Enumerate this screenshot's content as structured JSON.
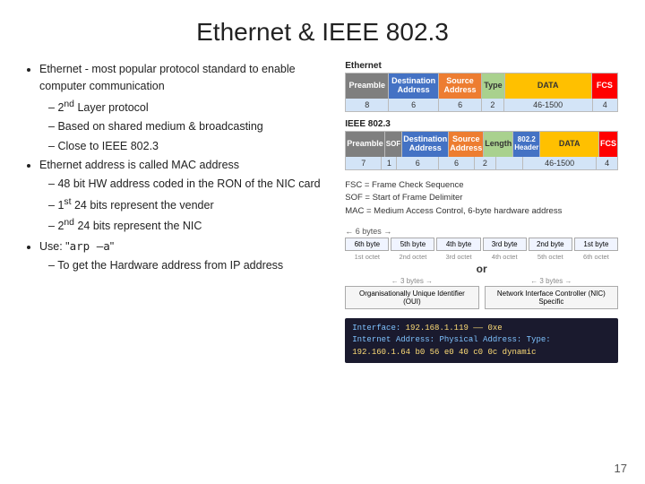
{
  "slide": {
    "title": "Ethernet & IEEE 802.3",
    "slide_number": "17"
  },
  "left": {
    "bullet1": "Ethernet - most popular protocol standard to enable computer communication",
    "sub1_1": "2nd Layer protocol",
    "sub1_2": "Based on shared medium & broadcasting",
    "sub1_3": "Close to IEEE 802.3",
    "bullet2": "Ethernet address is called MAC address",
    "sub2_1": "48 bit HW address coded in the RON of the NIC card",
    "sub2_2": "1st 24 bits represent the vender",
    "sub2_3": "2nd 24 bits represent the NIC",
    "bullet3": "Use: \"arp –a\"",
    "sub3_1": "To get the Hardware address from IP address"
  },
  "right": {
    "ethernet_label": "Ethernet",
    "ieee_label": "IEEE 802.3",
    "eth_cells": [
      "Preamble",
      "Destination Address",
      "Source Address",
      "Type",
      "DATA",
      "FCS"
    ],
    "eth_nums": [
      "8",
      "6",
      "6",
      "2",
      "46-1500",
      "4"
    ],
    "ieee_cells": [
      "Preamble",
      "SOF",
      "Destination Address",
      "Source Address",
      "Length",
      "802.2 Header",
      "DATA",
      "FCS"
    ],
    "ieee_nums": [
      "7",
      "1",
      "6",
      "6",
      "2",
      "46-1500",
      "4"
    ],
    "legend": {
      "fsc": "FSC = Frame Check Sequence",
      "sof": "SOF = Start of Frame Delimiter",
      "mac": "MAC = Medium Access Control, 6-byte hardware address"
    },
    "six_bytes_label": "← 6 bytes →",
    "byte_labels": [
      "6th byte",
      "5th byte",
      "4th byte",
      "3rd byte",
      "2nd byte",
      "1st byte"
    ],
    "octet_labels": [
      "1st octet",
      "2nd octet",
      "3rd octet",
      "4th octet",
      "5th octet",
      "6th octet"
    ],
    "or_label": "or",
    "three_bytes_label1": "← 3 bytes →",
    "three_bytes_label2": "← 3 bytes →",
    "oui_label": "Organisationally Unique Identifier (OUI)",
    "nic_label": "Network Interface Controller (NIC) Specific",
    "terminal": {
      "line1_label": "Interface: ",
      "line1_val": "192.168.1.119 ——  0xe",
      "line2_label": "Internet Address:  ",
      "line2_val": "Physical Address:        Type:",
      "line3": "192.160.1.64    b0 56 e0 40 c0 0c    dynamic"
    }
  }
}
